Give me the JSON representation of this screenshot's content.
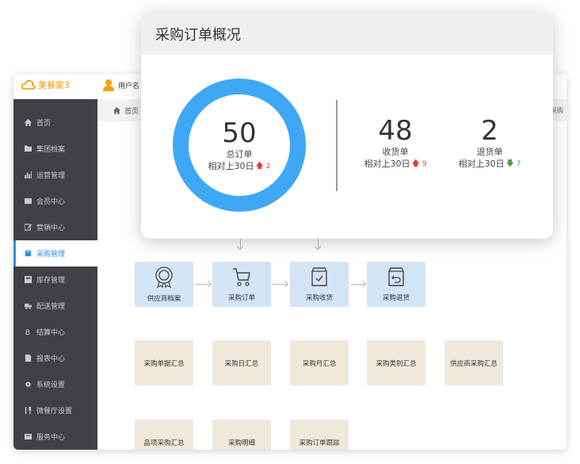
{
  "app": {
    "logo_text": "美餐家3",
    "user_text": "用户名"
  },
  "sidebar": {
    "items": [
      {
        "label": "首页",
        "icon": "home-icon"
      },
      {
        "label": "集团档案",
        "icon": "folder-icon"
      },
      {
        "label": "运营管理",
        "icon": "bar-chart-icon"
      },
      {
        "label": "会员中心",
        "icon": "id-card-icon"
      },
      {
        "label": "营销中心",
        "icon": "edit-icon"
      },
      {
        "label": "采购管理",
        "icon": "book-icon",
        "active": true
      },
      {
        "label": "库存管理",
        "icon": "storage-icon"
      },
      {
        "label": "配送管理",
        "icon": "truck-icon"
      },
      {
        "label": "结算中心",
        "icon": "bitcoin-icon"
      },
      {
        "label": "报表中心",
        "icon": "document-icon"
      },
      {
        "label": "系统设置",
        "icon": "gear-icon"
      },
      {
        "label": "微餐厅设置",
        "icon": "utensils-icon"
      },
      {
        "label": "服务中心",
        "icon": "service-icon"
      }
    ]
  },
  "breadcrumb": {
    "home": "首页",
    "right": "采购"
  },
  "flow": {
    "supplier": "供应商档案",
    "order": "采购订单",
    "receive": "采购收货",
    "return": "采购退货"
  },
  "reports": {
    "row1": [
      "采购单据汇总",
      "采购日汇总",
      "采购月汇总",
      "采购类别汇总",
      "供应商采购汇总"
    ],
    "row2": [
      "品项采购汇总",
      "采购明细",
      "采购订单跟踪"
    ]
  },
  "card": {
    "title": "采购订单概况",
    "total": {
      "value": "50",
      "label": "总订单",
      "compare": "相对上30日",
      "delta": "2",
      "trend": "up"
    },
    "received": {
      "value": "48",
      "label": "收货单",
      "compare": "相对上30日",
      "delta": "9",
      "trend": "up"
    },
    "returned": {
      "value": "2",
      "label": "退货单",
      "compare": "相对上30日",
      "delta": "7",
      "trend": "down"
    }
  },
  "colors": {
    "ring": "#3ea8f6",
    "accent": "#2f8de4",
    "up": "#e53935",
    "down": "#43a047",
    "sidebar": "#3e4146"
  }
}
